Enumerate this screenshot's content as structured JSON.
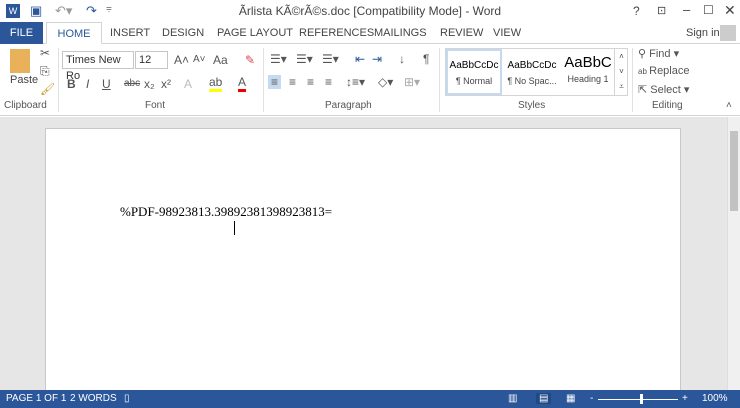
{
  "titlebar": {
    "title": "Ãrlista KÃ©rÃ©s.doc [Compatibility Mode] - Word",
    "help": "?",
    "sign_in": "Sign in"
  },
  "tabs": [
    "FILE",
    "HOME",
    "INSERT",
    "DESIGN",
    "PAGE LAYOUT",
    "REFERENCES",
    "MAILINGS",
    "REVIEW",
    "VIEW"
  ],
  "ribbon": {
    "clipboard": {
      "paste": "Paste",
      "label": "Clipboard"
    },
    "font": {
      "name": "Times New Ro",
      "size": "12",
      "label": "Font",
      "bold": "B",
      "italic": "I",
      "underline": "U",
      "strike": "abc",
      "sub": "x₂",
      "sup": "x²",
      "case": "Aa"
    },
    "paragraph": {
      "label": "Paragraph"
    },
    "styles": {
      "items": [
        {
          "preview": "AaBbCcDc",
          "name": "¶ Normal"
        },
        {
          "preview": "AaBbCcDc",
          "name": "¶ No Spac..."
        },
        {
          "preview": "AaBbC",
          "name": "Heading 1"
        }
      ],
      "label": "Styles"
    },
    "editing": {
      "find": "Find",
      "replace": "Replace",
      "select": "Select",
      "label": "Editing"
    }
  },
  "document": {
    "text": "%PDF-98923813.39892381398923813="
  },
  "status": {
    "page": "PAGE 1 OF 1",
    "words": "2 WORDS",
    "zoom": "100%",
    "zoom_minus": "-",
    "zoom_plus": "+"
  }
}
